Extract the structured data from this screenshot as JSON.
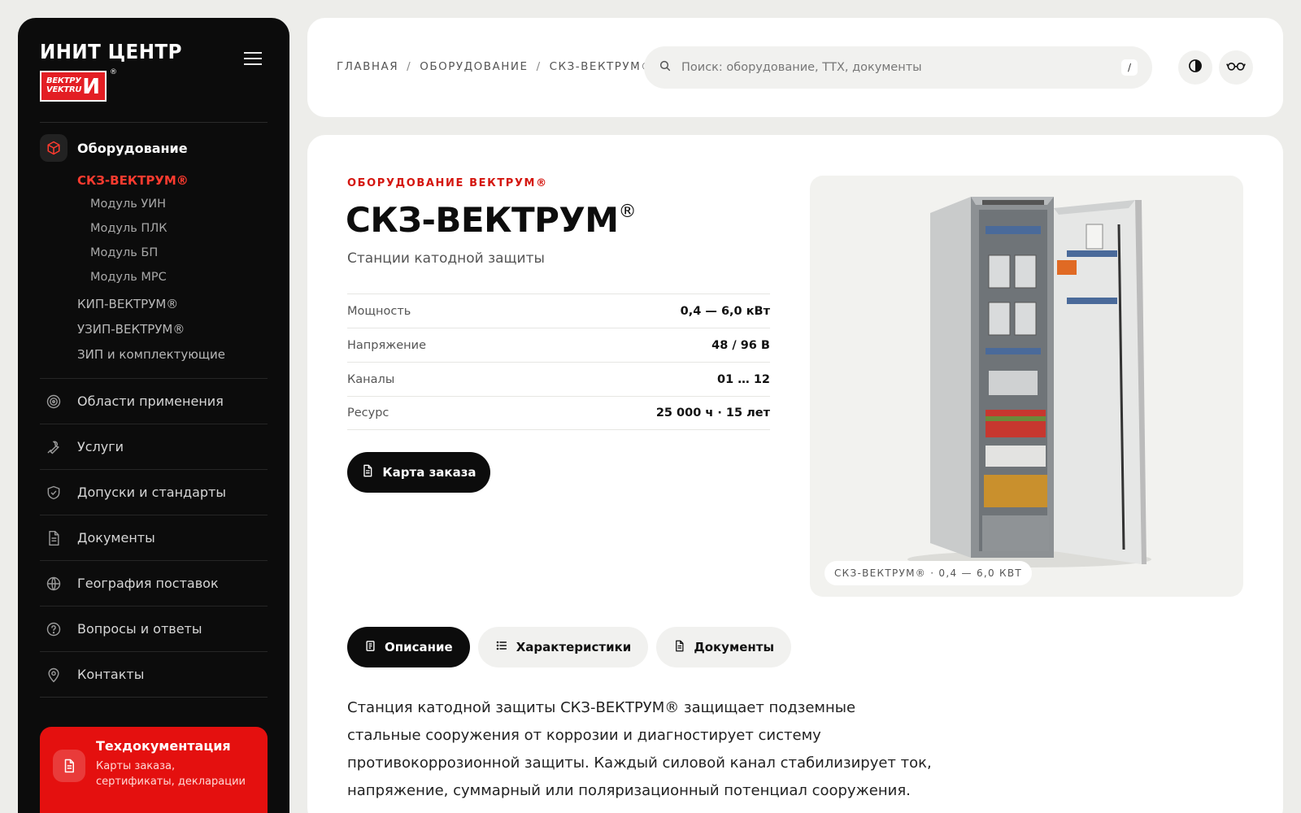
{
  "sidebar": {
    "brand_title": "ИНИТ ЦЕНТР",
    "logo_text": "ВЕКТРУ VEKTRU",
    "logo_mark": "И",
    "reg": "®",
    "section_label": "Оборудование",
    "products": [
      {
        "label": "СКЗ-ВЕКТРУМ®",
        "active": true
      },
      {
        "label": "КИП-ВЕКТРУМ®",
        "active": false
      },
      {
        "label": "УЗИП-ВЕКТРУМ®",
        "active": false
      },
      {
        "label": "ЗИП и комплектующие",
        "active": false
      }
    ],
    "modules": [
      "Модуль УИН",
      "Модуль ПЛК",
      "Модуль БП",
      "Модуль МРС"
    ],
    "nav": [
      {
        "label": "Области применения",
        "icon": "target-icon"
      },
      {
        "label": "Услуги",
        "icon": "wrench-icon"
      },
      {
        "label": "Допуски и стандарты",
        "icon": "shield-check-icon"
      },
      {
        "label": "Документы",
        "icon": "document-icon"
      },
      {
        "label": "География поставок",
        "icon": "globe-icon"
      },
      {
        "label": "Вопросы и ответы",
        "icon": "question-icon"
      },
      {
        "label": "Контакты",
        "icon": "map-pin-icon"
      }
    ],
    "techdoc": {
      "title": "Техдокументация",
      "subtitle": "Карты заказа, сертификаты, декларации"
    }
  },
  "header": {
    "breadcrumbs": [
      "ГЛАВНАЯ",
      "ОБОРУДОВАНИЕ",
      "СКЗ-ВЕКТРУМ®"
    ],
    "search_placeholder": "Поиск: оборудование, ТТХ, документы",
    "search_shortcut": "/"
  },
  "product": {
    "eyebrow": "ОБОРУДОВАНИЕ ВЕКТРУМ®",
    "title": "СКЗ-ВЕКТРУМ",
    "title_reg": "®",
    "subtitle": "Станции катодной защиты",
    "specs": [
      {
        "key": "Мощность",
        "value": "0,4 — 6,0 кВт"
      },
      {
        "key": "Напряжение",
        "value": "48 / 96 В"
      },
      {
        "key": "Каналы",
        "value": "01 … 12"
      },
      {
        "key": "Ресурс",
        "value": "25 000 ч · 15 лет"
      }
    ],
    "order_button": "Карта заказа",
    "photo_caption": "СКЗ-ВЕКТРУМ® · 0,4 — 6,0 КВТ",
    "tabs": [
      "Описание",
      "Характеристики",
      "Документы"
    ],
    "description": "Станция катодной защиты СКЗ-ВЕКТРУМ® защищает подземные стальные сооружения от коррозии и диагностирует систему противокоррозионной защиты. Каждый силовой канал стабилизирует ток, напряжение, суммарный или поляризационный потенциал сооружения."
  },
  "colors": {
    "accent": "#e4100f",
    "dark": "#0c0c0c",
    "background": "#ededea"
  }
}
